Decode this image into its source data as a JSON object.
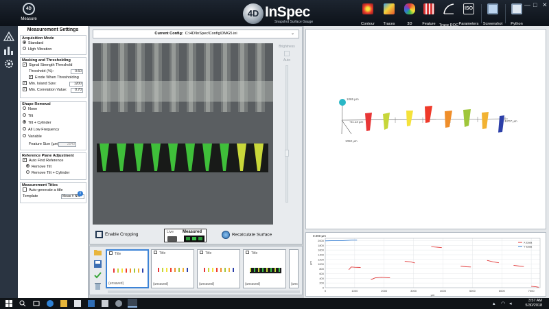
{
  "app": {
    "measure_label": "Measure",
    "logo_disc": "4D",
    "brand": "4D InSpec",
    "tagline": "Snapshot Surface Gauge",
    "tools": [
      {
        "label": "Contour",
        "icon": "contour-icon",
        "color": "#e8382b"
      },
      {
        "label": "Traces",
        "icon": "traces-icon",
        "color": "#e5532a"
      },
      {
        "label": "3D",
        "icon": "3d-icon",
        "color": "#f29a2e"
      },
      {
        "label": "Feature",
        "icon": "feature-icon",
        "color": "#d93636"
      },
      {
        "label": "Trace ROC",
        "icon": "trace-roc-icon",
        "color": "#ffffff"
      },
      {
        "label": "Parameters",
        "icon": "iso-parameters-icon",
        "color": "#e6e6e6"
      },
      {
        "label": "Screenshot",
        "icon": "screenshot-icon",
        "color": "#bcd4ee"
      },
      {
        "label": "Python",
        "icon": "python-icon",
        "color": "#bcd4ee"
      }
    ],
    "iso_text": "ISO",
    "window_controls": {
      "minimize": "—",
      "maximize": "□",
      "close": "✕"
    }
  },
  "settings": {
    "title": "Measurement Settings",
    "acquisition": {
      "title": "Acquisition Mode",
      "options": [
        "Standard",
        "High Vibration"
      ],
      "selected": "Standard"
    },
    "masking": {
      "title": "Masking and Thresholding",
      "signal_strength": "Signal Strength Threshold",
      "threshold_label": "Threshold (%):",
      "threshold_value": "0.60",
      "erode": "Erode When Thresholding",
      "min_island_label": "Min. Island Size:",
      "min_island_value": "1200",
      "min_corr_label": "Min. Correlation Value:",
      "min_corr_value": "0.70"
    },
    "shape_removal": {
      "title": "Shape Removal",
      "options": [
        "None",
        "Tilt",
        "Tilt + Cylinder",
        "All Low Frequency",
        "Variable"
      ],
      "selected": "Tilt + Cylinder",
      "feature_size_label": "Feature Size (µm)",
      "feature_size_value": "2540"
    },
    "reference": {
      "title": "Reference Plane Adjustment",
      "auto_find": "Auto Find Reference",
      "options": [
        "Remove Tilt",
        "Remove Tilt + Cylinder"
      ],
      "selected": "Remove Tilt"
    },
    "titles": {
      "title": "Measurement Titles",
      "auto_generate": "Auto-generate a title",
      "template_label": "Template",
      "template_value": "Meas # NN"
    }
  },
  "middle": {
    "config_label": "Current Config:",
    "config_path": "C:\\4D\\InSpec\\Config\\DMG5.ini",
    "brightness_label": "Brightness",
    "auto_label": "Auto",
    "enable_cropping": "Enable Cropping",
    "live_label": "Live",
    "measured_label": "Measured",
    "recalculate": "Recalculate Surface"
  },
  "thumbnails": [
    {
      "title": "Title",
      "status": "(unsaved)",
      "selected": true
    },
    {
      "title": "Title",
      "status": "(unsaved)",
      "selected": false
    },
    {
      "title": "Title",
      "status": "(unsaved)",
      "selected": false
    },
    {
      "title": "Title",
      "status": "(unsaved)",
      "selected": false
    },
    {
      "title": "",
      "status": "(uns",
      "selected": false
    }
  ],
  "view3d": {
    "label_top": "1065 µm",
    "label_mid": "-61.13 µm",
    "label_right": "5707 µm",
    "label_bottom": "1050 µm"
  },
  "chart_data": {
    "type": "line",
    "title": "0.000 µm",
    "xlabel": "µm",
    "ylabel": "µm",
    "xlim": [
      0,
      7300
    ],
    "ylim": [
      0,
      2100
    ],
    "x_ticks": [
      0,
      1000,
      2000,
      3000,
      4000,
      5000,
      6000,
      7000
    ],
    "y_ticks": [
      0,
      200,
      400,
      600,
      800,
      1000,
      1200,
      1400,
      1600,
      1800,
      2000
    ],
    "legend": "top-right",
    "series": [
      {
        "name": "X Data",
        "color": "#e23a3a",
        "segments": [
          [
            [
              800,
              760
            ],
            [
              880,
              880
            ],
            [
              1000,
              870
            ],
            [
              1200,
              860
            ]
          ],
          [
            [
              1550,
              340
            ],
            [
              1700,
              420
            ],
            [
              1900,
              440
            ],
            [
              2200,
              420
            ]
          ],
          [
            [
              2700,
              1120
            ],
            [
              2900,
              1100
            ],
            [
              3050,
              1050
            ]
          ],
          [
            [
              3600,
              1740
            ],
            [
              3800,
              1720
            ],
            [
              3960,
              1700
            ]
          ],
          [
            [
              4600,
              920
            ],
            [
              4800,
              890
            ],
            [
              4950,
              880
            ]
          ],
          [
            [
              5500,
              1160
            ],
            [
              5700,
              1100
            ],
            [
              5900,
              1060
            ]
          ],
          [
            [
              6400,
              950
            ],
            [
              6600,
              920
            ],
            [
              6750,
              900
            ]
          ],
          [
            [
              7000,
              60
            ],
            [
              7150,
              40
            ],
            [
              7250,
              20
            ]
          ]
        ]
      },
      {
        "name": "Y Data",
        "color": "#2e7ad1",
        "segments": [
          [
            [
              0,
              1990
            ],
            [
              300,
              2000
            ],
            [
              600,
              2000
            ],
            [
              900,
              2020
            ],
            [
              1080,
              2020
            ]
          ]
        ]
      }
    ]
  },
  "taskbar": {
    "time": "3:57 AM",
    "date": "5/30/2018"
  }
}
